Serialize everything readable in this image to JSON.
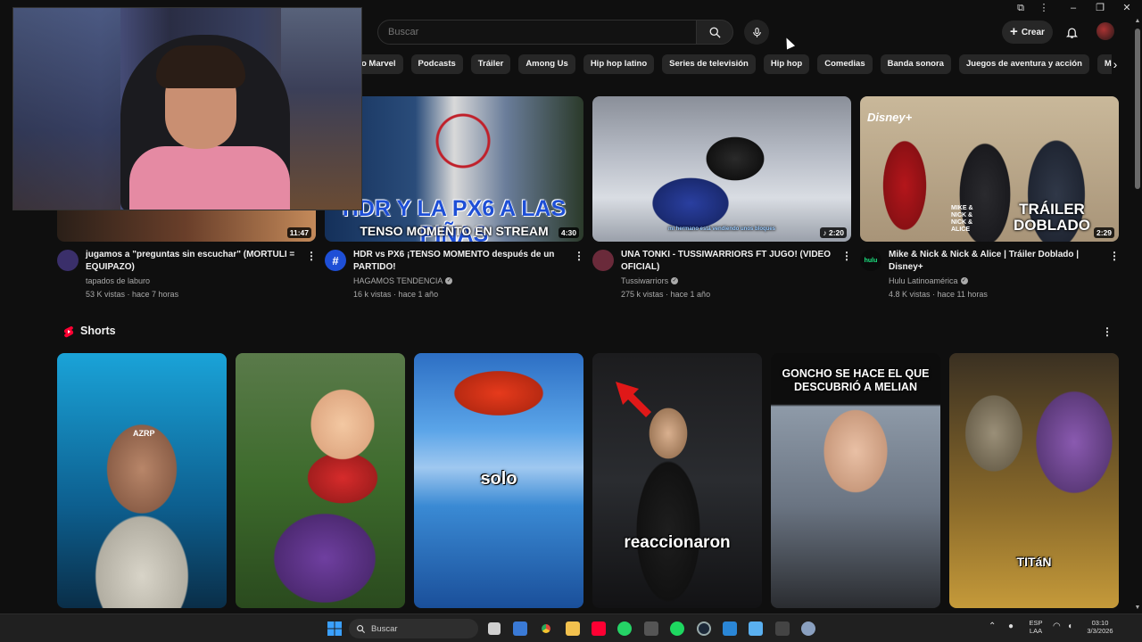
{
  "header": {
    "search_placeholder": "Buscar",
    "create_label": "Crear"
  },
  "chips": [
    "rso Marvel",
    "Podcasts",
    "Tráiler",
    "Among Us",
    "Hip hop latino",
    "Series de televisión",
    "Hip hop",
    "Comedias",
    "Banda sonora",
    "Juegos de aventura y acción",
    "Música pop"
  ],
  "videos": [
    {
      "title": "jugamos a \"preguntas sin escuchar\" (MORTULI = EQUIPAZO)",
      "channel": "tapados de laburo",
      "verified": false,
      "views": "53 K vistas",
      "age": "hace 7 horas",
      "duration": "11:47",
      "avatar_color": "#3a2f6a"
    },
    {
      "title": "HDR vs PX6 ¡TENSO MOMENTO después de un PARTIDO!",
      "channel": "HAGAMOS TENDENCIA",
      "verified": true,
      "views": "16 k vistas",
      "age": "hace 1 año",
      "duration": "4:30",
      "caption_top": "HDR Y LA PX6 A LAS PIÑAS",
      "caption_bottom": "TENSO MOMENTO EN STREAM",
      "avatar_color": "#1e4fd6"
    },
    {
      "title": "UNA TONKI - TUSSIWARRIORS FT JUGO! (VIDEO OFICIAL)",
      "channel": "Tussiwarriors",
      "verified": true,
      "views": "275 k vistas",
      "age": "hace 1 año",
      "duration": "2:20",
      "subtitle": "mi hermano está vendiendo unos bloques",
      "avatar_color": "#6a2a3a"
    },
    {
      "title": "Mike & Nick & Nick & Alice | Tráiler Doblado | Disney+",
      "channel": "Hulu Latinoamérica",
      "verified": true,
      "views": "4.8 K vistas",
      "age": "hace 11 horas",
      "duration": "2:29",
      "brand": "Disney+",
      "caption": "TRÁILER DOBLADO",
      "poster_text": "MIKE & NICK & NICK & ALICE",
      "avatar_label": "hulu",
      "avatar_color": "#0b0b0b"
    }
  ],
  "shorts": {
    "title": "Shorts",
    "items": [
      {
        "overlay": "",
        "cap_label": "AZRP"
      },
      {
        "overlay": ""
      },
      {
        "overlay": "solo"
      },
      {
        "overlay": "reaccionaron"
      },
      {
        "overlay_top": "GONCHO SE HACE EL QUE DESCUBRIÓ A MELIAN"
      },
      {
        "overlay": "TITáN"
      }
    ]
  },
  "taskbar": {
    "search_label": "Buscar",
    "lang_top": "ESP",
    "lang_bottom": "LAA",
    "time": "03:10",
    "date": "3/3/2026"
  }
}
